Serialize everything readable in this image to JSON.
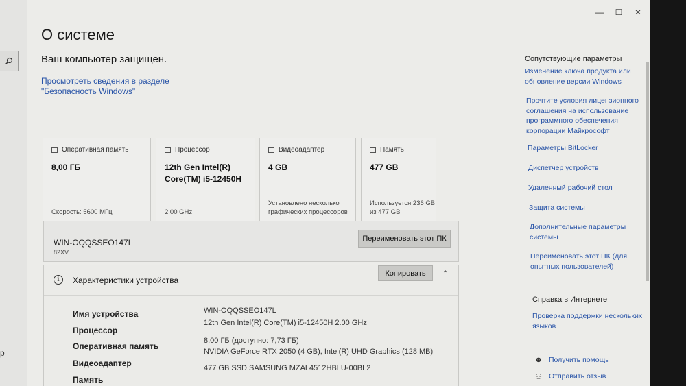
{
  "page": {
    "title": "О системе",
    "protection_status": "Ваш компьютер защищен.",
    "security_link": "Просмотреть сведения в разделе \"Безопасность Windows\""
  },
  "window_controls": {
    "minimize": "—",
    "maximize": "☐",
    "close": "✕"
  },
  "cards": [
    {
      "label": "Оперативная память",
      "value": "8,00 ГБ",
      "note": "Скорость: 5600 МГц"
    },
    {
      "label": "Процессор",
      "value": "12th Gen Intel(R) Core(TM) i5-12450H",
      "note": "2.00 GHz"
    },
    {
      "label": "Видеоадаптер",
      "value": "4 GB",
      "note": "Установлено несколько графических процессоров"
    },
    {
      "label": "Память",
      "value": "477 GB",
      "note": "Используется 236 GB из 477 GB"
    }
  ],
  "device_name": {
    "name": "WIN-OQQSSEO147L",
    "model": "82XV",
    "rename_button": "Переименовать этот ПК"
  },
  "specs": {
    "title": "Характеристики устройства",
    "copy_button": "Копировать",
    "rows": [
      {
        "label": "Имя устройства",
        "value": "WIN-OQQSSEO147L"
      },
      {
        "label": "Процессор",
        "value": "12th Gen Intel(R) Core(TM) i5-12450H   2.00 GHz"
      },
      {
        "label": "Оперативная память",
        "value": "8,00 ГБ (доступно: 7,73 ГБ)"
      },
      {
        "label": "Видеоадаптер",
        "value": "NVIDIA GeForce RTX 2050 (4 GB), Intel(R) UHD Graphics (128 MB)"
      },
      {
        "label": "Память",
        "value": "477 GB SSD SAMSUNG MZAL4512HBLU-00BL2"
      }
    ]
  },
  "related": {
    "title": "Сопутствующие параметры",
    "links": [
      "Изменение ключа продукта или обновление версии Windows",
      "Прочтите условия лицензионного соглашения на использование программного обеспечения корпорации Майкрософт",
      "Параметры BitLocker",
      "Диспетчер устройств",
      "Удаленный рабочий стол",
      "Защита системы",
      "Дополнительные параметры системы",
      "Переименовать этот ПК (для опытных пользователей)"
    ]
  },
  "web_help": {
    "title": "Справка в Интернете",
    "links": [
      "Проверка поддержки нескольких языков"
    ]
  },
  "bottom_links": [
    "Получить помощь",
    "Отправить отзыв"
  ],
  "left_fragment": "р"
}
